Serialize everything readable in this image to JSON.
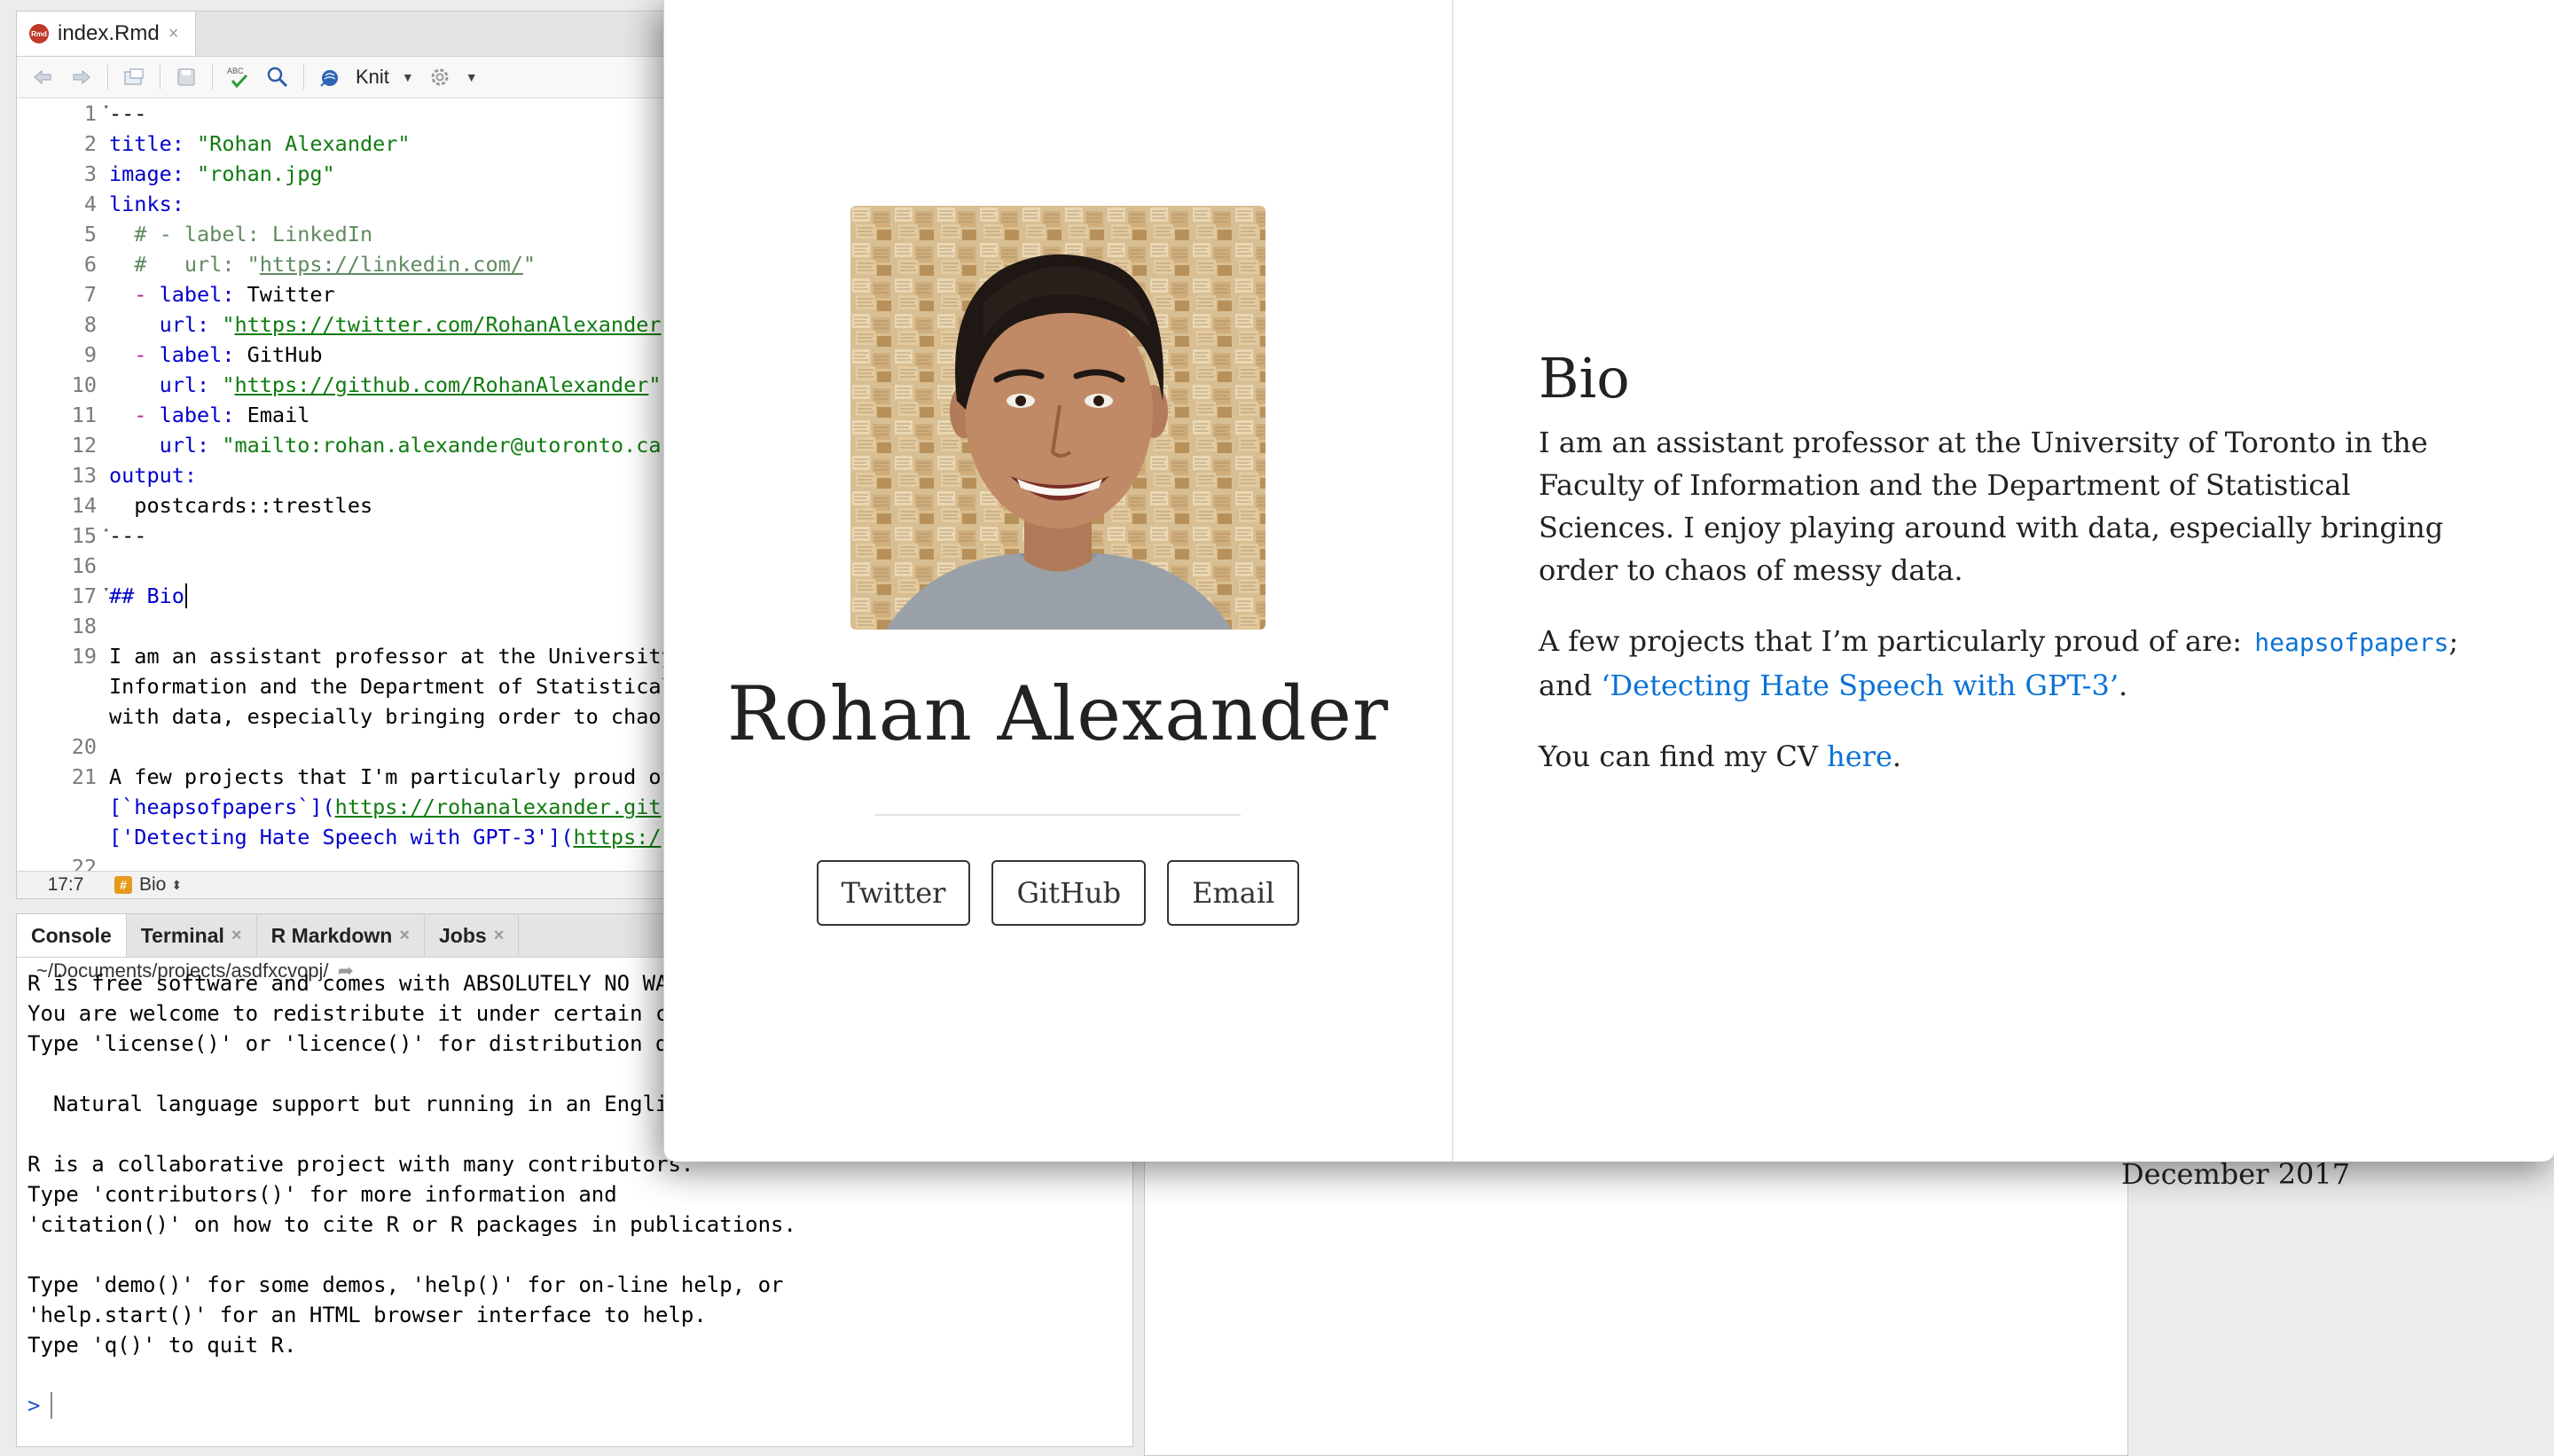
{
  "editor": {
    "tab": {
      "filename": "index.Rmd",
      "badge": "Rmd",
      "close": "×"
    },
    "toolbar": {
      "knit_label": "Knit",
      "spell_label": "ABC"
    },
    "lines": [
      {
        "n": "1",
        "fold": "▾"
      },
      {
        "n": "2"
      },
      {
        "n": "3"
      },
      {
        "n": "4"
      },
      {
        "n": "5"
      },
      {
        "n": "6"
      },
      {
        "n": "7"
      },
      {
        "n": "8"
      },
      {
        "n": "9"
      },
      {
        "n": "10"
      },
      {
        "n": "11"
      },
      {
        "n": "12"
      },
      {
        "n": "13"
      },
      {
        "n": "14"
      },
      {
        "n": "15",
        "fold": "▴"
      },
      {
        "n": "16"
      },
      {
        "n": "17",
        "fold": "▾"
      },
      {
        "n": "18"
      },
      {
        "n": "19"
      },
      {
        "n": "20"
      },
      {
        "n": "21"
      },
      {
        "n": "22"
      }
    ],
    "code": {
      "l1": "---",
      "l2_key": "title:",
      "l2_val": " \"Rohan Alexander\"",
      "l3_key": "image:",
      "l3_val": " \"rohan.jpg\"",
      "l4_key": "links:",
      "l5": "  # - label: LinkedIn",
      "l6_a": "  #   url: \"",
      "l6_url": "https://linkedin.com/",
      "l6_b": "\"",
      "l7_dash": "  - ",
      "l7_key": "label:",
      "l7_val": " Twitter",
      "l8_key": "    url:",
      "l8_a": " \"",
      "l8_url": "https://twitter.com/RohanAlexander",
      "l9_dash": "  - ",
      "l9_key": "label:",
      "l9_val": " GitHub",
      "l10_key": "    url:",
      "l10_a": " \"",
      "l10_url": "https://github.com/RohanAlexander",
      "l10_b": "\"",
      "l11_dash": "  - ",
      "l11_key": "label:",
      "l11_val": " Email",
      "l12_key": "    url:",
      "l12_val": " \"mailto:rohan.alexander@utoronto.ca",
      "l13_key": "output:",
      "l14": "  postcards::trestles",
      "l15": "---",
      "l17": "## Bio",
      "l19a": "I am an assistant professor at the University",
      "l19b": "Information and the Department of Statistical",
      "l19c": "with data, especially bringing order to chaos",
      "l21a": "A few projects that I'm particularly proud of",
      "l21b_a": "[`heapsofpapers`](",
      "l21b_url": "https://rohanalexander.git",
      "l21c_a": "['Detecting Hate Speech with GPT-3'](",
      "l21c_url": "https:/"
    },
    "status": {
      "position": "17:7",
      "section": "Bio",
      "section_icon": "#"
    }
  },
  "console": {
    "tabs": [
      {
        "label": "Console"
      },
      {
        "label": "Terminal",
        "close": "×"
      },
      {
        "label": "R Markdown",
        "close": "×"
      },
      {
        "label": "Jobs",
        "close": "×"
      }
    ],
    "path": "~/Documents/projects/asdfxcvopj/",
    "output": [
      "R is free software and comes with ABSOLUTELY NO WA",
      "You are welcome to redistribute it under certain c",
      "Type 'license()' or 'licence()' for distribution d",
      "",
      "  Natural language support but running in an Engli",
      "",
      "R is a collaborative project with many contributors.",
      "Type 'contributors()' for more information and",
      "'citation()' on how to cite R or R packages in publications.",
      "",
      "Type 'demo()' for some demos, 'help()' for on-line help, or",
      "'help.start()' for an HTML browser interface to help.",
      "Type 'q()' to quit R.",
      ""
    ],
    "prompt": ">"
  },
  "behind": {
    "date_text": "December 2017"
  },
  "preview": {
    "name": "Rohan Alexander",
    "links": [
      {
        "label": "Twitter"
      },
      {
        "label": "GitHub"
      },
      {
        "label": "Email"
      }
    ],
    "bio": {
      "heading": "Bio",
      "p1": "I am an assistant professor at the University of Toronto in the Faculty of Information and the Department of Statistical Sciences. I enjoy playing around with data, especially bringing order to chaos of messy data.",
      "p2_a": "A few projects that I’m particularly proud of are: ",
      "p2_link1": "heapsofpapers",
      "p2_b": "; and ",
      "p2_link2": "‘Detecting Hate Speech with GPT-3’",
      "p2_c": ".",
      "p3_a": "You can find my CV ",
      "p3_link": "here",
      "p3_b": "."
    }
  }
}
